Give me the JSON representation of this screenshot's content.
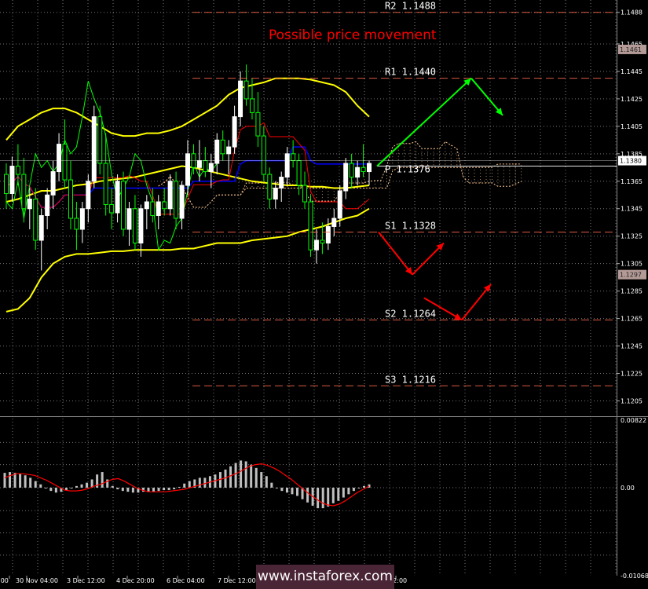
{
  "chart_data": [
    {
      "type": "candlestick",
      "title": "Possible price movement",
      "ylim": [
        1.1195,
        1.1497
      ],
      "y_ticks": [
        "1.1488",
        "1.1465",
        "1.1445",
        "1.1425",
        "1.1405",
        "1.1385",
        "1.1365",
        "1.1345",
        "1.1325",
        "1.1305",
        "1.1285",
        "1.1265",
        "1.1245",
        "1.1225",
        "1.1205"
      ],
      "x_tick_labels": [
        ":00",
        "30 Nov 04:00",
        "3 Dec 12:00",
        "4 Dec 20:00",
        "6 Dec 04:00",
        "7 Dec 12:00",
        "",
        ". 12:00"
      ],
      "current_price": "1.1380",
      "price_markers": [
        {
          "label": "1.1461",
          "value": 1.1461
        },
        {
          "label": "1.1297",
          "value": 1.1297
        }
      ],
      "pivot_levels": [
        {
          "name": "R2",
          "label": "R2 1.1488",
          "value": 1.1488
        },
        {
          "name": "R1",
          "label": "R1 1.1440",
          "value": 1.144
        },
        {
          "name": "P",
          "label": "P 1.1376",
          "value": 1.1376
        },
        {
          "name": "S1",
          "label": "S1 1.1328",
          "value": 1.1328
        },
        {
          "name": "S2",
          "label": "S2 1.1264",
          "value": 1.1264
        },
        {
          "name": "S3",
          "label": "S3 1.1216",
          "value": 1.1216
        }
      ],
      "candles": [
        [
          1.137,
          1.1378,
          1.1345,
          1.1356
        ],
        [
          1.1356,
          1.1383,
          1.135,
          1.1376
        ],
        [
          1.1376,
          1.1392,
          1.1362,
          1.137
        ],
        [
          1.137,
          1.1382,
          1.1335,
          1.1345
        ],
        [
          1.1345,
          1.136,
          1.133,
          1.1352
        ],
        [
          1.1352,
          1.136,
          1.1315,
          1.1322
        ],
        [
          1.1322,
          1.1345,
          1.13,
          1.134
        ],
        [
          1.134,
          1.136,
          1.133,
          1.1355
        ],
        [
          1.1355,
          1.138,
          1.1345,
          1.1372
        ],
        [
          1.1372,
          1.14,
          1.1365,
          1.1392
        ],
        [
          1.1392,
          1.141,
          1.136,
          1.1366
        ],
        [
          1.1366,
          1.138,
          1.133,
          1.1338
        ],
        [
          1.1338,
          1.135,
          1.1315,
          1.133
        ],
        [
          1.133,
          1.135,
          1.132,
          1.1345
        ],
        [
          1.1345,
          1.137,
          1.1335,
          1.1365
        ],
        [
          1.1365,
          1.142,
          1.136,
          1.1412
        ],
        [
          1.1412,
          1.142,
          1.137,
          1.1378
        ],
        [
          1.1378,
          1.14,
          1.134,
          1.1348
        ],
        [
          1.1348,
          1.136,
          1.133,
          1.1342
        ],
        [
          1.1342,
          1.137,
          1.1335,
          1.1365
        ],
        [
          1.1365,
          1.1372,
          1.1325,
          1.133
        ],
        [
          1.133,
          1.135,
          1.1318,
          1.1345
        ],
        [
          1.1345,
          1.1355,
          1.1315,
          1.132
        ],
        [
          1.132,
          1.1348,
          1.131,
          1.1345
        ],
        [
          1.1345,
          1.1355,
          1.133,
          1.135
        ],
        [
          1.135,
          1.136,
          1.1335,
          1.134
        ],
        [
          1.134,
          1.1355,
          1.133,
          1.135
        ],
        [
          1.135,
          1.136,
          1.134,
          1.1345
        ],
        [
          1.1345,
          1.137,
          1.134,
          1.1365
        ],
        [
          1.1365,
          1.1372,
          1.133,
          1.1338
        ],
        [
          1.1338,
          1.1365,
          1.133,
          1.1362
        ],
        [
          1.1362,
          1.1395,
          1.1355,
          1.1385
        ],
        [
          1.1385,
          1.1392,
          1.137,
          1.1375
        ],
        [
          1.1375,
          1.1395,
          1.1365,
          1.138
        ],
        [
          1.138,
          1.139,
          1.1368,
          1.1372
        ],
        [
          1.1372,
          1.1385,
          1.136,
          1.1378
        ],
        [
          1.1378,
          1.14,
          1.137,
          1.1395
        ],
        [
          1.1395,
          1.1402,
          1.138,
          1.1385
        ],
        [
          1.1385,
          1.1395,
          1.137,
          1.139
        ],
        [
          1.139,
          1.142,
          1.1385,
          1.1412
        ],
        [
          1.1412,
          1.1445,
          1.1405,
          1.1438
        ],
        [
          1.1438,
          1.145,
          1.142,
          1.1425
        ],
        [
          1.1425,
          1.144,
          1.141,
          1.1415
        ],
        [
          1.1415,
          1.143,
          1.139,
          1.1398
        ],
        [
          1.1398,
          1.1405,
          1.1365,
          1.137
        ],
        [
          1.137,
          1.1375,
          1.1345,
          1.1352
        ],
        [
          1.1352,
          1.1365,
          1.1345,
          1.136
        ],
        [
          1.136,
          1.1372,
          1.135,
          1.1368
        ],
        [
          1.1368,
          1.139,
          1.1362,
          1.1385
        ],
        [
          1.1385,
          1.1395,
          1.1375,
          1.138
        ],
        [
          1.138,
          1.1385,
          1.1355,
          1.1362
        ],
        [
          1.1362,
          1.1372,
          1.1345,
          1.135
        ],
        [
          1.135,
          1.1355,
          1.131,
          1.1315
        ],
        [
          1.1315,
          1.133,
          1.1305,
          1.1322
        ],
        [
          1.1322,
          1.1335,
          1.1312,
          1.132
        ],
        [
          1.132,
          1.1338,
          1.1315,
          1.1332
        ],
        [
          1.1332,
          1.1345,
          1.1325,
          1.1338
        ],
        [
          1.1338,
          1.1362,
          1.1332,
          1.1358
        ],
        [
          1.1358,
          1.1382,
          1.1352,
          1.1378
        ],
        [
          1.1378,
          1.1385,
          1.136,
          1.1368
        ],
        [
          1.1368,
          1.138,
          1.1362,
          1.1375
        ],
        [
          1.1375,
          1.1392,
          1.1368,
          1.1372
        ],
        [
          1.1372,
          1.138,
          1.1362,
          1.1378
        ]
      ],
      "bollinger": {
        "upper": [
          1.1395,
          1.1405,
          1.141,
          1.1415,
          1.1418,
          1.1418,
          1.1415,
          1.141,
          1.1405,
          1.14,
          1.1398,
          1.1398,
          1.14,
          1.14,
          1.1402,
          1.1405,
          1.141,
          1.1415,
          1.142,
          1.1428,
          1.1433,
          1.1435,
          1.1437,
          1.144,
          1.144,
          1.144,
          1.1439,
          1.1437,
          1.1435,
          1.143,
          1.142,
          1.1412
        ],
        "middle": [
          1.135,
          1.1352,
          1.1355,
          1.1358,
          1.1358,
          1.136,
          1.1362,
          1.1363,
          1.1365,
          1.1366,
          1.1367,
          1.1368,
          1.137,
          1.1372,
          1.1374,
          1.1376,
          1.1375,
          1.1373,
          1.1371,
          1.1369,
          1.1367,
          1.1365,
          1.1364,
          1.1363,
          1.1362,
          1.1362,
          1.1361,
          1.1361,
          1.136,
          1.136,
          1.1361,
          1.1362
        ],
        "lower": [
          1.127,
          1.1272,
          1.128,
          1.1295,
          1.1305,
          1.131,
          1.1312,
          1.1312,
          1.1313,
          1.1314,
          1.1314,
          1.1315,
          1.1315,
          1.1315,
          1.1315,
          1.1316,
          1.1316,
          1.1318,
          1.132,
          1.132,
          1.132,
          1.1322,
          1.1323,
          1.1324,
          1.1325,
          1.1328,
          1.133,
          1.1332,
          1.1335,
          1.1338,
          1.134,
          1.1345
        ]
      },
      "forecast_bullish": [
        [
          1.1376,
          0
        ],
        [
          1.144,
          1
        ],
        [
          1.1413,
          2
        ]
      ],
      "forecast_bearish": [
        [
          1.1328,
          0
        ],
        [
          1.1297,
          1
        ],
        [
          1.132,
          2
        ],
        [
          1.128,
          3
        ],
        [
          1.1264,
          4
        ],
        [
          1.129,
          5
        ]
      ]
    },
    {
      "type": "bar",
      "name": "MACD",
      "ylim": [
        -0.0107,
        0.0084
      ],
      "y_ticks": [
        "0.00822",
        "0.00",
        "-0.01068"
      ],
      "values": [
        0.0018,
        0.0019,
        0.0018,
        0.0017,
        0.0015,
        0.0012,
        0.0008,
        0.0004,
        0.0,
        -0.0004,
        -0.0006,
        -0.0005,
        -0.0003,
        -0.0001,
        0.0002,
        0.0004,
        0.0006,
        0.001,
        0.0016,
        0.0019,
        0.001,
        0.0002,
        -0.0002,
        -0.0004,
        -0.0005,
        -0.0006,
        -0.0006,
        -0.0005,
        -0.0005,
        -0.0005,
        -0.0004,
        -0.0003,
        -0.0003,
        -0.0002,
        0.0001,
        0.0005,
        0.0008,
        0.001,
        0.0012,
        0.0012,
        0.0014,
        0.0016,
        0.0019,
        0.0022,
        0.0026,
        0.003,
        0.0033,
        0.0032,
        0.0028,
        0.0024,
        0.0019,
        0.0014,
        0.0006,
        0.0,
        -0.0004,
        -0.0006,
        -0.0008,
        -0.001,
        -0.0014,
        -0.0018,
        -0.0022,
        -0.0025,
        -0.0025,
        -0.0023,
        -0.0019,
        -0.0016,
        -0.0012,
        -0.0008,
        -0.0004,
        -0.0001,
        0.0002,
        0.0004
      ],
      "signal": [
        0.0012,
        0.0015,
        0.0017,
        0.0017,
        0.0016,
        0.0015,
        0.0012,
        0.0009,
        0.0005,
        0.0001,
        -0.0003,
        -0.0004,
        -0.0004,
        -0.0003,
        -0.0001,
        0.0002,
        0.0004,
        0.0007,
        0.001,
        0.0011,
        0.0008,
        0.0004,
        0.0,
        -0.0003,
        -0.0005,
        -0.0005,
        -0.0005,
        -0.0005,
        -0.0004,
        -0.0003,
        -0.0002,
        0.0,
        0.0002,
        0.0004,
        0.0006,
        0.0008,
        0.001,
        0.0012,
        0.0015,
        0.0018,
        0.0022,
        0.0026,
        0.0028,
        0.0029,
        0.0027,
        0.0024,
        0.002,
        0.0015,
        0.001,
        0.0004,
        -0.0002,
        -0.0008,
        -0.0013,
        -0.0018,
        -0.0021,
        -0.0022,
        -0.002,
        -0.0016,
        -0.0011,
        -0.0006,
        -0.0002,
        0.0002
      ]
    }
  ],
  "watermark": "www.instaforex.com",
  "colors": {
    "background": "#000000",
    "grid": "#ffffff",
    "bullish_candle": "#ffffff",
    "bearish_candle": "#00ff00",
    "bollinger": "#ffff00",
    "kijun": "#0000ff",
    "tenkan": "#ff0000",
    "cloud": "#f5c08a",
    "forecast_up": "#00ff00",
    "forecast_down": "#ff0000",
    "forecast_title": "#ff0000",
    "macd_hist": "#c0c0c0",
    "macd_signal": "#ff0000",
    "watermark_bg": "#4a2535"
  }
}
